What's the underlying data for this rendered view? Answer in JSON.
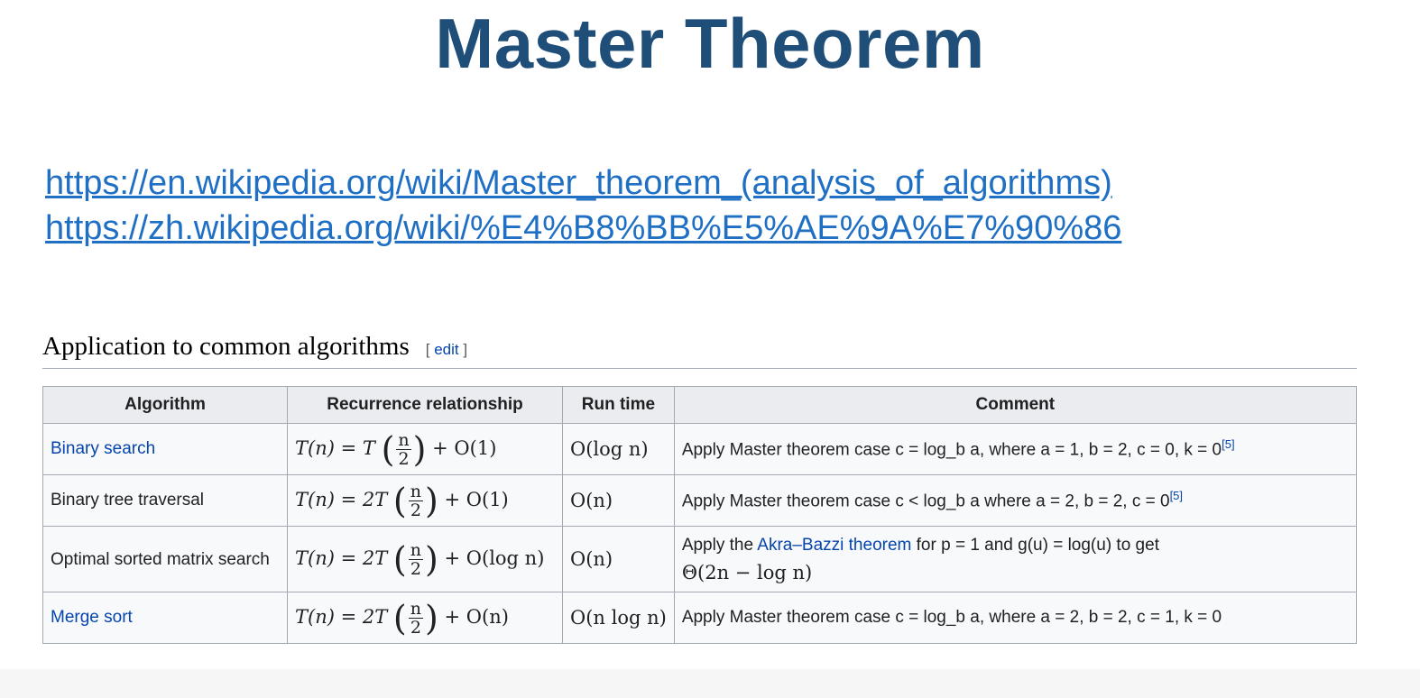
{
  "title": "Master Theorem",
  "links": [
    "https://en.wikipedia.org/wiki/Master_theorem_(analysis_of_algorithms)",
    "https://zh.wikipedia.org/wiki/%E4%B8%BB%E5%AE%9A%E7%90%86"
  ],
  "section": {
    "title": "Application to common algorithms",
    "edit_label": "edit"
  },
  "table": {
    "headers": [
      "Algorithm",
      "Recurrence relationship",
      "Run time",
      "Comment"
    ],
    "rows": [
      {
        "algorithm": "Binary search",
        "recurrence_lhs": "T(n) = T",
        "frac_num": "n",
        "frac_den": "2",
        "recurrence_rhs": "+ O(1)",
        "runtime": "O(log n)",
        "comment": "Apply Master theorem case c = log_b a, where a = 1, b = 2, c = 0, k = 0",
        "ref": "[5]"
      },
      {
        "algorithm": "Binary tree traversal",
        "recurrence_lhs": "T(n) = 2T",
        "frac_num": "n",
        "frac_den": "2",
        "recurrence_rhs": "+ O(1)",
        "runtime": "O(n)",
        "comment": "Apply Master theorem case c < log_b a where a = 2, b = 2, c = 0",
        "ref": "[5]"
      },
      {
        "algorithm": "Optimal sorted matrix search",
        "recurrence_lhs": "T(n) = 2T",
        "frac_num": "n",
        "frac_den": "2",
        "recurrence_rhs": "+ O(log n)",
        "runtime": "O(n)",
        "comment_prefix": "Apply the",
        "comment_link": "Akra–Bazzi theorem",
        "comment_mid": "for p = 1 and g(u) = log(u) to get",
        "comment_line2": "Θ(2n − log n)"
      },
      {
        "algorithm": "Merge sort",
        "recurrence_lhs": "T(n) = 2T",
        "frac_num": "n",
        "frac_den": "2",
        "recurrence_rhs": "+ O(n)",
        "runtime": "O(n log n)",
        "comment": "Apply Master theorem case c = log_b a, where a = 2, b = 2, c = 1, k = 0"
      }
    ]
  }
}
